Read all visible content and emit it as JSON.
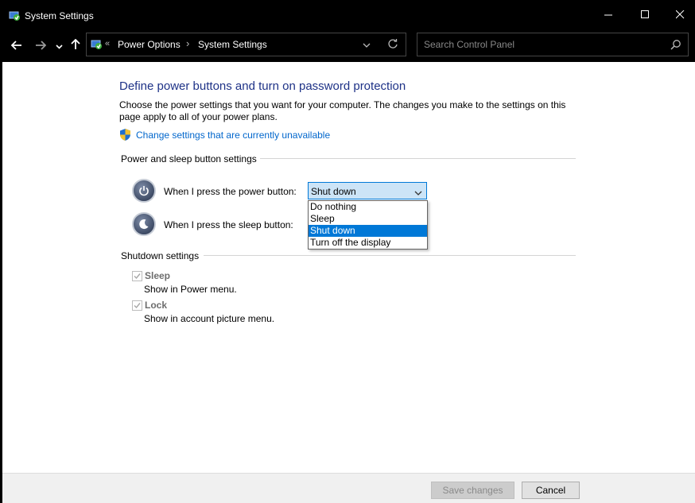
{
  "window": {
    "title": "System Settings",
    "controls": {
      "minimize": "minimize-icon",
      "maximize": "maximize-icon",
      "close": "close-icon"
    }
  },
  "navigation": {
    "back_icon": "back-arrow-icon",
    "forward_icon": "forward-arrow-icon",
    "recent_icon": "chevron-down-icon",
    "up_icon": "up-arrow-icon",
    "breadcrumb": [
      "Power Options",
      "System Settings"
    ],
    "breadcrumb_separator_first": "«",
    "breadcrumb_separator": "›",
    "search_placeholder": "Search Control Panel"
  },
  "main": {
    "heading": "Define power buttons and turn on password protection",
    "description": "Choose the power settings that you want for your computer. The changes you make to the settings on this page apply to all of your power plans.",
    "link": "Change settings that are currently unavailable",
    "power_sleep_section": {
      "title": "Power and sleep button settings",
      "power_label": "When I press the power button:",
      "power_value": "Shut down",
      "sleep_label": "When I press the sleep button:",
      "dropdown_options": [
        "Do nothing",
        "Sleep",
        "Shut down",
        "Turn off the display"
      ],
      "selected_option": "Shut down"
    },
    "shutdown_section": {
      "title": "Shutdown settings",
      "items": [
        {
          "label": "Sleep",
          "desc": "Show in Power menu.",
          "checked": true
        },
        {
          "label": "Lock",
          "desc": "Show in account picture menu.",
          "checked": true
        }
      ]
    }
  },
  "footer": {
    "save_label": "Save changes",
    "cancel_label": "Cancel"
  },
  "colors": {
    "heading": "#1e3287",
    "link": "#0066cc",
    "selection": "#0078d7",
    "combo_bg": "#cce4f7"
  }
}
